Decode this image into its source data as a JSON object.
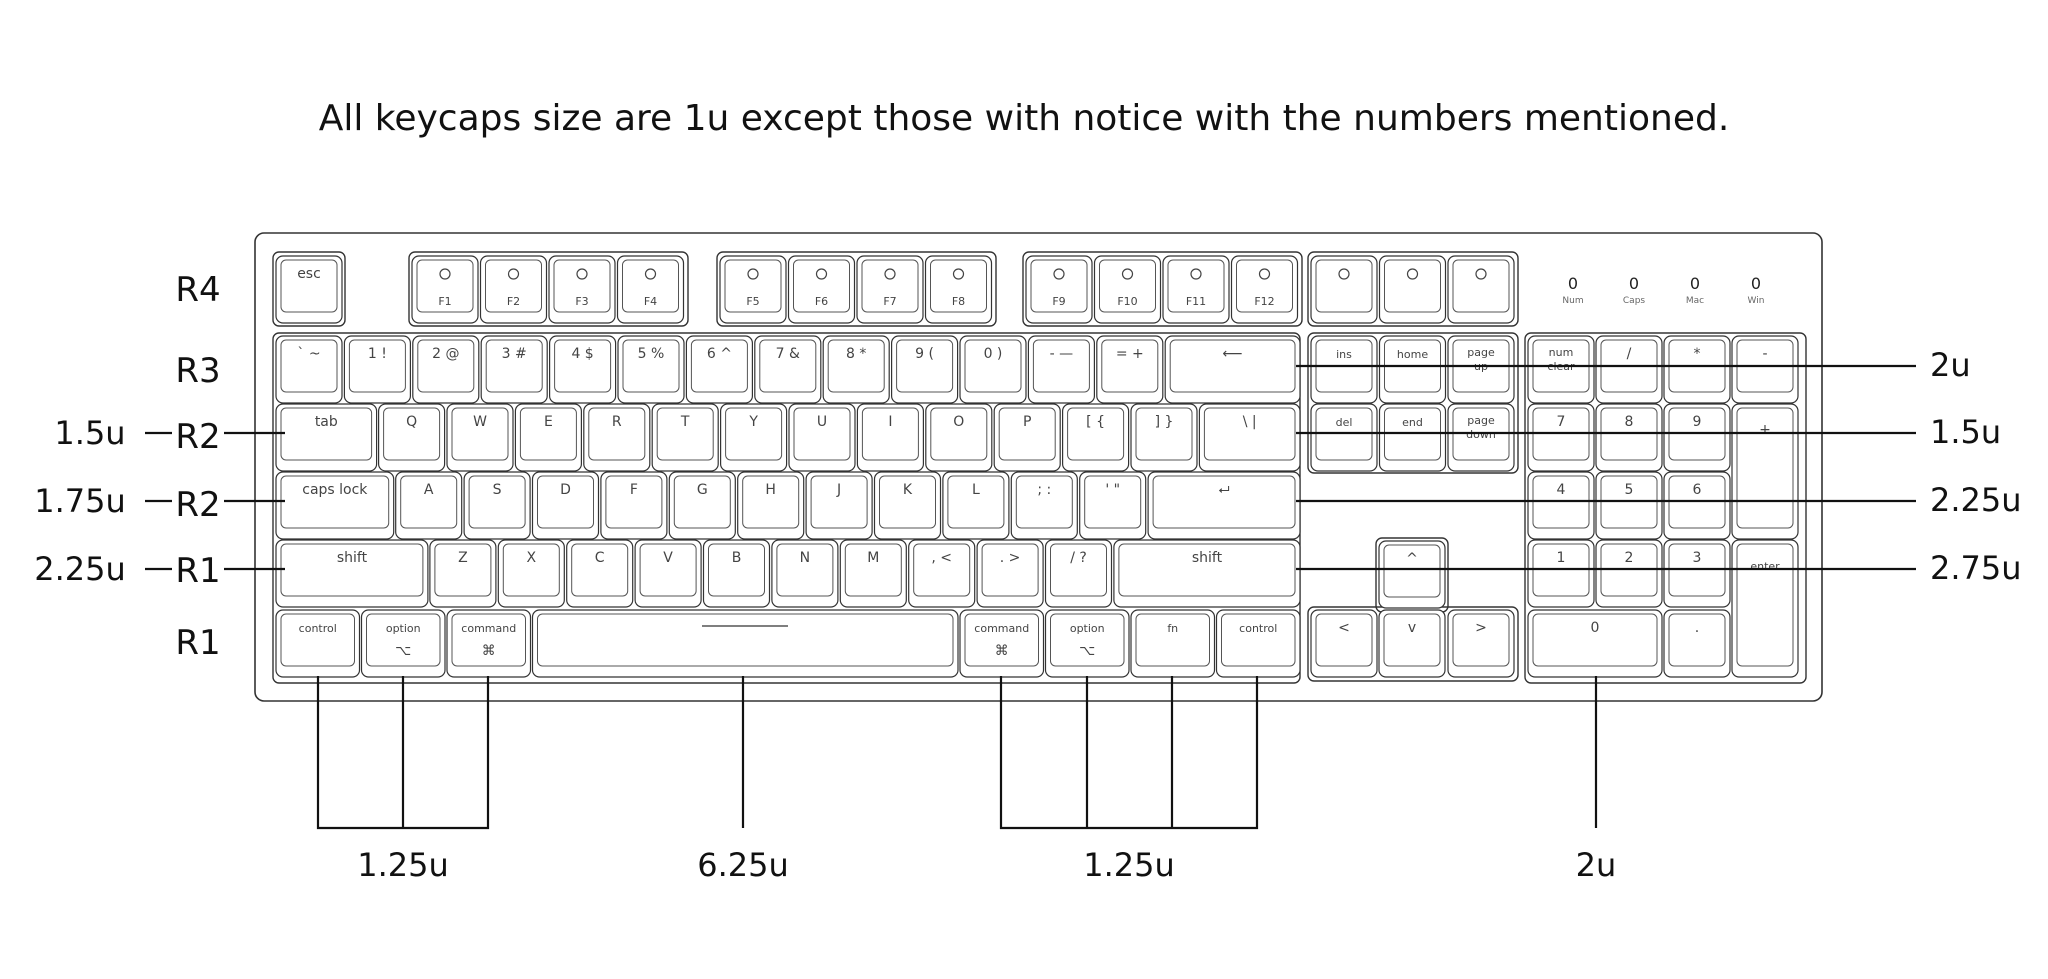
{
  "headline": "All keycaps size are 1u except those with notice with the numbers mentioned.",
  "row_labels": [
    {
      "id": "r4",
      "text": "R4"
    },
    {
      "id": "r3",
      "text": "R3"
    },
    {
      "id": "r2a",
      "text": "R2",
      "size": "1.5u"
    },
    {
      "id": "r2b",
      "text": "R2",
      "size": "1.75u"
    },
    {
      "id": "r1a",
      "text": "R1",
      "size": "2.25u"
    },
    {
      "id": "r1b",
      "text": "R1"
    }
  ],
  "right_callouts": [
    "2u",
    "1.5u",
    "2.25u",
    "2.75u"
  ],
  "bottom_callouts": [
    "1.25u",
    "6.25u",
    "1.25u",
    "2u"
  ],
  "indicators": [
    {
      "value": "0",
      "label": "Num"
    },
    {
      "value": "0",
      "label": "Caps"
    },
    {
      "value": "0",
      "label": "Mac"
    },
    {
      "value": "0",
      "label": "Win"
    }
  ],
  "keys": {
    "esc": "esc",
    "function_row": [
      "F1",
      "F2",
      "F3",
      "F4",
      "F5",
      "F6",
      "F7",
      "F8",
      "F9",
      "F10",
      "F11",
      "F12"
    ],
    "function_icons": [
      "backlight-down-icon",
      "backlight-up-icon",
      "mission-control-icon",
      "launchpad-icon",
      "keyboard-light-down-icon",
      "keyboard-light-up-icon",
      "rewind-icon",
      "play-pause-icon",
      "fast-forward-icon",
      "mute-icon",
      "volume-down-icon",
      "volume-up-icon"
    ],
    "top_right_icons": [
      "screenshot-icon",
      "microphone-icon",
      "light-bulb-icon"
    ],
    "number_row": [
      "` ~",
      "1 !",
      "2 @",
      "3 #",
      "4 $",
      "5 %",
      "6 ^",
      "7 &",
      "8 *",
      "9 (",
      "0 )",
      "- —",
      "= +"
    ],
    "backspace": "⟵",
    "q_row": [
      "tab",
      "Q",
      "W",
      "E",
      "R",
      "T",
      "Y",
      "U",
      "I",
      "O",
      "P",
      "[ {",
      "] }",
      "\\ |"
    ],
    "a_row": [
      "caps lock",
      "A",
      "S",
      "D",
      "F",
      "G",
      "H",
      "J",
      "K",
      "L",
      "; :",
      "' \""
    ],
    "enter": "⮠",
    "z_row": [
      "shift",
      "Z",
      "X",
      "C",
      "V",
      "B",
      "N",
      "M",
      ", <",
      ". >",
      "/ ?",
      "shift"
    ],
    "bottom_row": [
      "control",
      "option",
      "command",
      "",
      "command",
      "option",
      "fn",
      "control"
    ],
    "bottom_row_icons": [
      "",
      "⌥",
      "⌘",
      "",
      "⌘",
      "⌥",
      "",
      ""
    ],
    "nav_top": [
      "ins",
      "home",
      "page up"
    ],
    "nav_mid": [
      "del",
      "end",
      "page down"
    ],
    "arrows": [
      "^",
      "<",
      "v",
      ">"
    ],
    "numpad": [
      "num clear",
      "/",
      "*",
      "-",
      "7",
      "8",
      "9",
      "+",
      "4",
      "5",
      "6",
      "1",
      "2",
      "3",
      "enter",
      "0",
      "."
    ]
  }
}
